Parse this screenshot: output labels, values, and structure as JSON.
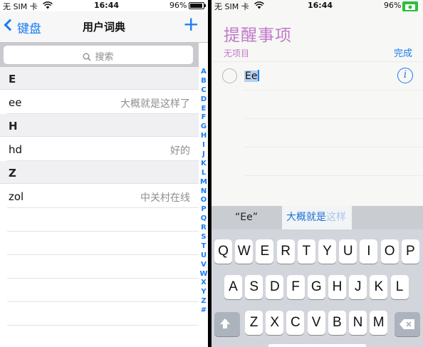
{
  "left": {
    "status": {
      "carrier": "无 SIM 卡",
      "time": "16:44",
      "battery_pct": "96%",
      "battery_level": 0.96
    },
    "nav": {
      "back_label": "键盘",
      "title": "用户词典",
      "add_glyph": "+"
    },
    "search": {
      "placeholder": "搜索"
    },
    "sections": [
      {
        "header": "E",
        "rows": [
          {
            "term": "ee",
            "meaning": "大概就是这样了"
          }
        ]
      },
      {
        "header": "H",
        "rows": [
          {
            "term": "hd",
            "meaning": "好的"
          }
        ]
      },
      {
        "header": "Z",
        "rows": [
          {
            "term": "zol",
            "meaning": "中关村在线"
          }
        ]
      }
    ],
    "index": [
      "A",
      "B",
      "C",
      "D",
      "E",
      "F",
      "G",
      "H",
      "I",
      "J",
      "K",
      "L",
      "M",
      "N",
      "O",
      "P",
      "Q",
      "R",
      "S",
      "T",
      "U",
      "V",
      "W",
      "X",
      "Y",
      "Z",
      "#"
    ]
  },
  "right": {
    "status": {
      "carrier": "无 SIM 卡",
      "time": "16:44",
      "battery_pct": "96%",
      "battery_level": 0.96
    },
    "title": "提醒事项",
    "subtitle": "无项目",
    "done_label": "完成",
    "input_text": "Ee",
    "info_glyph": "i",
    "predictions": {
      "first": "“Ee”",
      "second_main": "大概就是",
      "second_faded": "这样"
    },
    "keyboard": {
      "row1": [
        "Q",
        "W",
        "E",
        "R",
        "T",
        "Y",
        "U",
        "I",
        "O",
        "P"
      ],
      "row2": [
        "A",
        "S",
        "D",
        "F",
        "G",
        "H",
        "J",
        "K",
        "L"
      ],
      "row3": [
        "Z",
        "X",
        "C",
        "V",
        "B",
        "N",
        "M"
      ]
    }
  },
  "colors": {
    "accent": "#1a7cf2",
    "reminders_purple": "#c079c9"
  }
}
